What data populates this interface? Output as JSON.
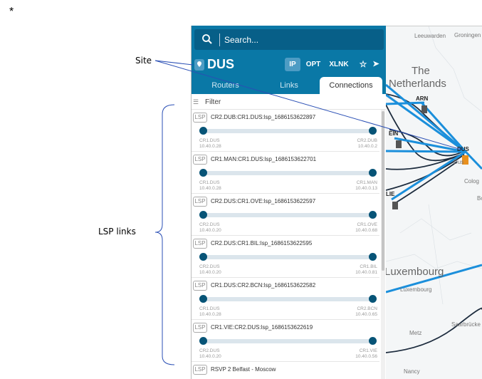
{
  "annotations": {
    "star": "*",
    "site": "Site",
    "lsp_links": "LSP links"
  },
  "search": {
    "placeholder": "Search...",
    "icon": "search-icon"
  },
  "site": {
    "name": "DUS",
    "icon": "map-pin-icon"
  },
  "header_buttons": [
    {
      "label": "IP",
      "active": true
    },
    {
      "label": "OPT"
    },
    {
      "label": "XLNK"
    },
    {
      "label": "☆",
      "icon": "star-icon"
    },
    {
      "label": "➤",
      "icon": "navigate-icon"
    }
  ],
  "tabs": [
    {
      "label": "Routers"
    },
    {
      "label": "Links"
    },
    {
      "label": "Connections",
      "active": true
    }
  ],
  "filter": {
    "label": "Filter",
    "icon": "filter-icon"
  },
  "connections": [
    {
      "type": "LSP",
      "name": "CR2.DUB:CR1.DUS:lsp_1686153622897",
      "a_name": "CR1.DUS",
      "a_ip": "10.40.0.28",
      "z_name": "CR2.DUB",
      "z_ip": "10.40.0.2"
    },
    {
      "type": "LSP",
      "name": "CR1.MAN:CR1.DUS:lsp_1686153622701",
      "a_name": "CR1.DUS",
      "a_ip": "10.40.0.28",
      "z_name": "CR1.MAN",
      "z_ip": "10.40.0.13"
    },
    {
      "type": "LSP",
      "name": "CR2.DUS:CR1.OVE:lsp_1686153622597",
      "a_name": "CR2.DUS",
      "a_ip": "10.40.0.20",
      "z_name": "CR1.OVE",
      "z_ip": "10.40.0.68"
    },
    {
      "type": "LSP",
      "name": "CR2.DUS:CR1.BIL:lsp_1686153622595",
      "a_name": "CR2.DUS",
      "a_ip": "10.40.0.20",
      "z_name": "CR1.BIL",
      "z_ip": "10.40.0.81"
    },
    {
      "type": "LSP",
      "name": "CR1.DUS:CR2.BCN:lsp_1686153622582",
      "a_name": "CR1.DUS",
      "a_ip": "10.40.0.28",
      "z_name": "CR2.BCN",
      "z_ip": "10.40.0.65"
    },
    {
      "type": "LSP",
      "name": "CR1.VIE:CR2.DUS:lsp_1686153622619",
      "a_name": "CR2.DUS",
      "a_ip": "10.40.0.20",
      "z_name": "CR1.VIE",
      "z_ip": "10.40.0.56"
    },
    {
      "type": "LSP",
      "name": "RSVP 2 Belfast - Moscow"
    }
  ],
  "map": {
    "labels": {
      "leeuwarden": "Leeuwarden",
      "groningen": "Groningen",
      "country1a": "The",
      "country1b": "Netherlands",
      "country2": "Luxembourg",
      "city_lux": "Luxembourg",
      "metz": "Metz",
      "saarbrucken": "Saarbrücke",
      "nancy": "Nancy",
      "cologne": "Colog",
      "bonn": "Bo",
      "dusseldorf": "Dus"
    },
    "sites": {
      "arn": "ARN",
      "ein": "EIN",
      "lie": "LIE",
      "dus": "DUS"
    },
    "colors": {
      "link": "#1b8fdb",
      "fiber": "#1c2b3d",
      "site": "#e8901e"
    }
  }
}
